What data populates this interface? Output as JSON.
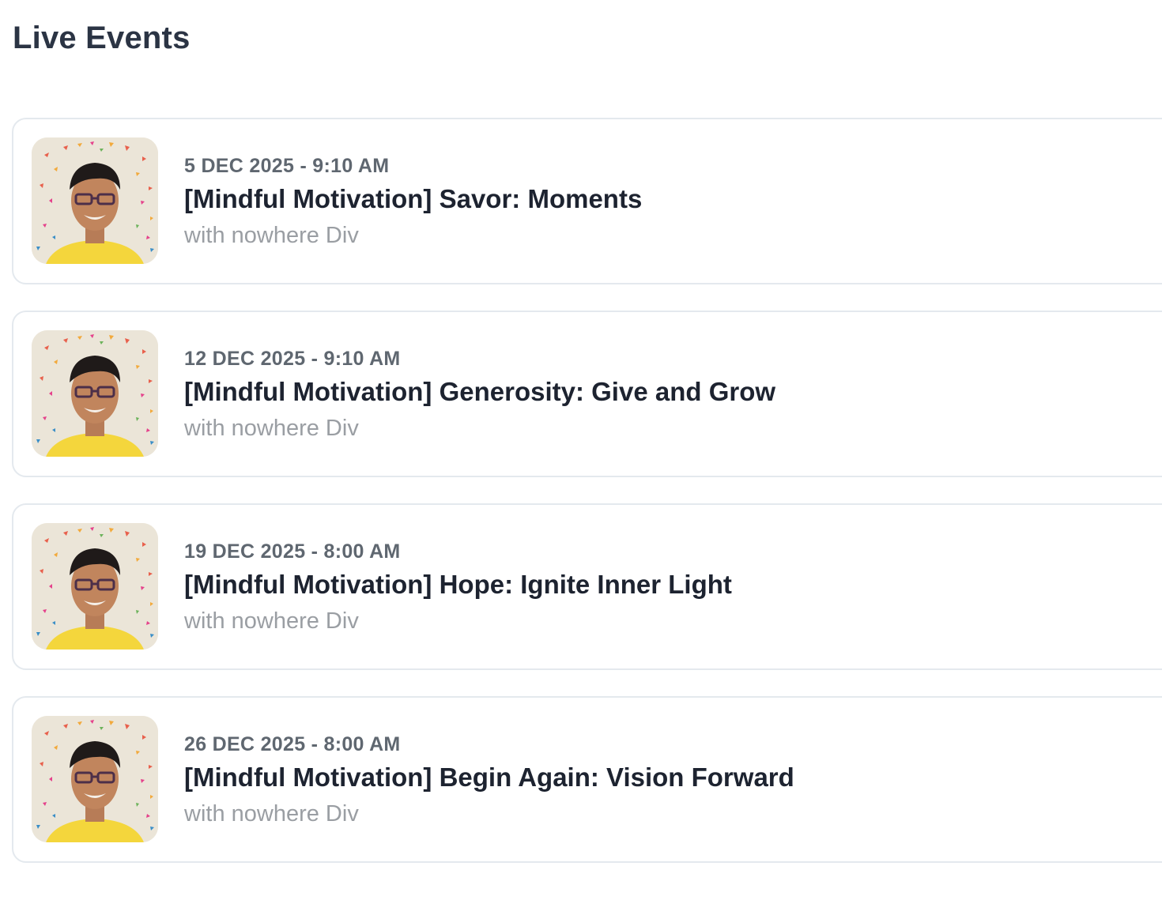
{
  "header": {
    "title": "Live Events"
  },
  "colors": {
    "title": "#2b3444",
    "date": "#5f6770",
    "event_title": "#1d2330",
    "host": "#9a9ea3",
    "card_border": "#e4e9ee"
  },
  "events": [
    {
      "date": "5 DEC 2025 - 9:10 AM",
      "title": "[Mindful Motivation] Savor: Moments",
      "host": "with nowhere Div",
      "thumbnail": "host-portrait"
    },
    {
      "date": "12 DEC 2025 - 9:10 AM",
      "title": "[Mindful Motivation] Generosity: Give and Grow",
      "host": "with nowhere Div",
      "thumbnail": "host-portrait"
    },
    {
      "date": "19 DEC 2025 - 8:00 AM",
      "title": "[Mindful Motivation] Hope: Ignite Inner Light",
      "host": "with nowhere Div",
      "thumbnail": "host-portrait"
    },
    {
      "date": "26 DEC 2025 - 8:00 AM",
      "title": "[Mindful Motivation] Begin Again: Vision Forward",
      "host": "with nowhere Div",
      "thumbnail": "host-portrait"
    }
  ]
}
